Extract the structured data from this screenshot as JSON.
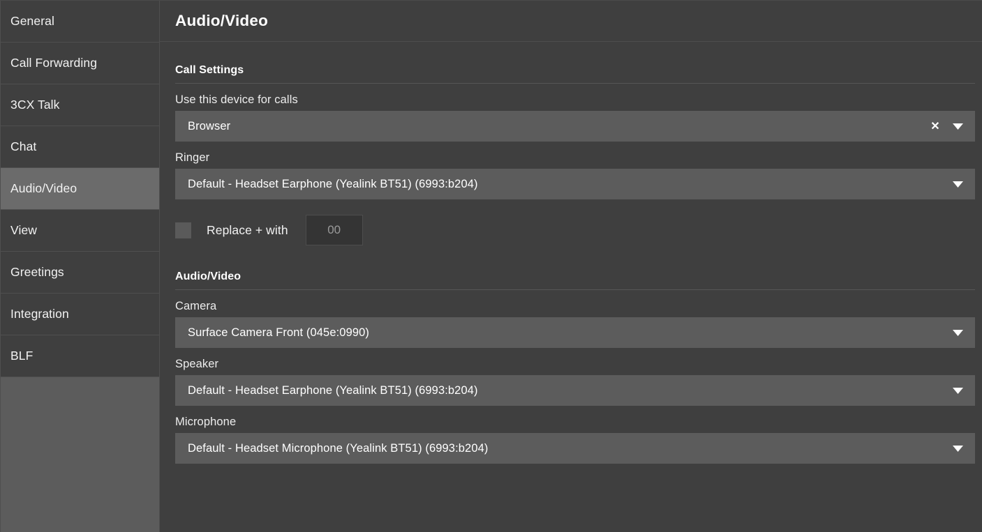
{
  "sidebar": {
    "items": [
      {
        "label": "General",
        "selected": false
      },
      {
        "label": "Call Forwarding",
        "selected": false
      },
      {
        "label": "3CX Talk",
        "selected": false
      },
      {
        "label": "Chat",
        "selected": false
      },
      {
        "label": "Audio/Video",
        "selected": true
      },
      {
        "label": "View",
        "selected": false
      },
      {
        "label": "Greetings",
        "selected": false
      },
      {
        "label": "Integration",
        "selected": false
      },
      {
        "label": "BLF",
        "selected": false
      }
    ]
  },
  "header": {
    "title": "Audio/Video"
  },
  "sections": {
    "call_settings": {
      "heading": "Call Settings",
      "device_for_calls": {
        "label": "Use this device for calls",
        "value": "Browser",
        "clear_icon": "close-x-icon",
        "caret_icon": "chevron-down-icon"
      },
      "ringer": {
        "label": "Ringer",
        "value": "Default - Headset Earphone (Yealink BT51) (6993:b204)",
        "caret_icon": "chevron-down-icon"
      },
      "replace_plus": {
        "label": "Replace + with",
        "checked": false,
        "input_value": "",
        "input_placeholder": "00"
      }
    },
    "audio_video": {
      "heading": "Audio/Video",
      "camera": {
        "label": "Camera",
        "value": "Surface Camera Front (045e:0990)",
        "caret_icon": "chevron-down-icon"
      },
      "speaker": {
        "label": "Speaker",
        "value": "Default - Headset Earphone (Yealink BT51) (6993:b204)",
        "caret_icon": "chevron-down-icon"
      },
      "microphone": {
        "label": "Microphone",
        "value": "Default - Headset Microphone (Yealink BT51) (6993:b204)",
        "caret_icon": "chevron-down-icon"
      }
    }
  },
  "colors": {
    "page_background": "#3f3f3f",
    "sidebar_background": "#5c5c5c",
    "field_background": "#5c5c5c",
    "selected_item": "#6b6b6b",
    "divider": "#4f4f4f",
    "text": "#ffffff"
  }
}
